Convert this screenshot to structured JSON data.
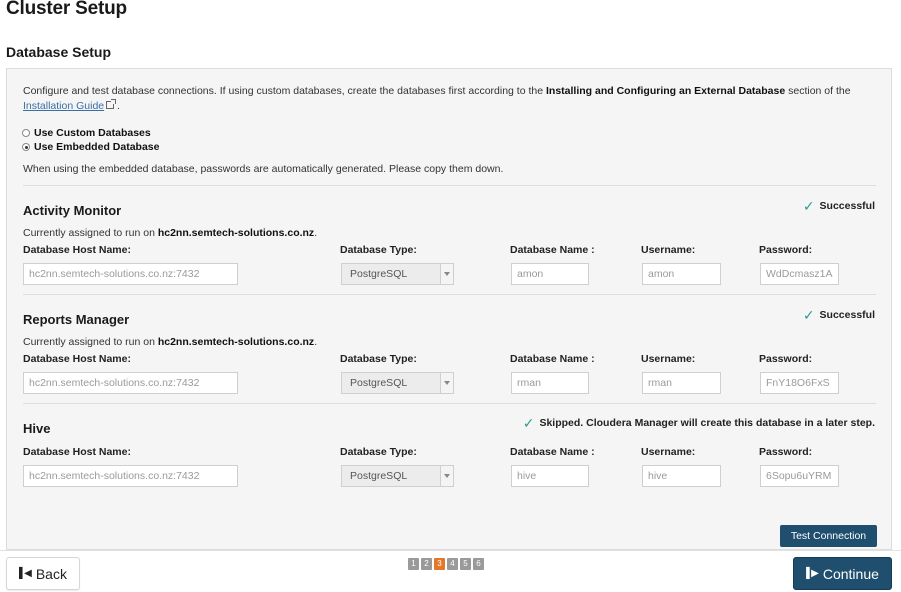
{
  "page": {
    "title": "Cluster Setup",
    "section": "Database Setup"
  },
  "intro": {
    "text1": "Configure and test database connections. If using custom databases, create the databases first according to the ",
    "bold": "Installing and Configuring an External Database",
    "text2": " section of the ",
    "link": "Installation Guide",
    "text3": " ."
  },
  "options": {
    "custom": "Use Custom Databases",
    "embedded": "Use Embedded Database",
    "selected": "embedded"
  },
  "note": "When using the embedded database, passwords are automatically generated. Please copy them down.",
  "labels": {
    "host": "Database Host Name:",
    "type": "Database Type:",
    "name": "Database Name :",
    "user": "Username:",
    "pass": "Password:",
    "assigned_prefix": "Currently assigned to run on ",
    "assigned_suffix": "."
  },
  "services": [
    {
      "title": "Activity Monitor",
      "status": "Successful",
      "assigned_host": "hc2nn.semtech-solutions.co.nz",
      "host": "hc2nn.semtech-solutions.co.nz:7432",
      "type": "PostgreSQL",
      "db_name": "amon",
      "username": "amon",
      "password": "WdDcmasz1A"
    },
    {
      "title": "Reports Manager",
      "status": "Successful",
      "assigned_host": "hc2nn.semtech-solutions.co.nz",
      "host": "hc2nn.semtech-solutions.co.nz:7432",
      "type": "PostgreSQL",
      "db_name": "rman",
      "username": "rman",
      "password": "FnY18O6FxS"
    },
    {
      "title": "Hive",
      "status": "Skipped. Cloudera Manager will create this database in a later step.",
      "host": "hc2nn.semtech-solutions.co.nz:7432",
      "type": "PostgreSQL",
      "db_name": "hive",
      "username": "hive",
      "password": "6Sopu6uYRM"
    }
  ],
  "buttons": {
    "test": "Test Connection",
    "back": "Back",
    "continue": "Continue"
  },
  "pager": {
    "pages": [
      "1",
      "2",
      "3",
      "4",
      "5",
      "6"
    ],
    "current": "3"
  },
  "colors": {
    "primary": "#1f4e6e",
    "success_check": "#2a9d8f",
    "pager_active": "#e4782a"
  }
}
